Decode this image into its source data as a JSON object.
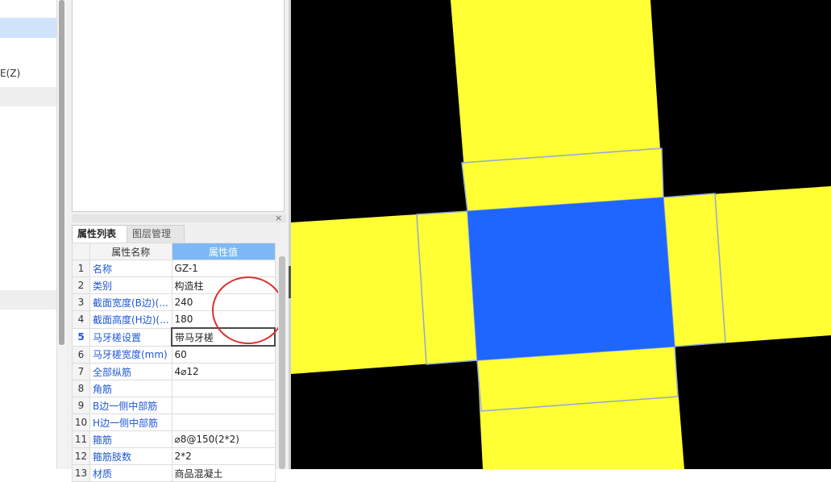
{
  "left_panel": {
    "truncated_label": "E(Z)"
  },
  "property_panel": {
    "tabs": [
      {
        "label": "属性列表",
        "active": true
      },
      {
        "label": "图层管理",
        "active": false
      }
    ],
    "close_glyph": "×",
    "columns": {
      "num": "",
      "name": "属性名称",
      "value": "属性值"
    },
    "selected_row": 5,
    "rows": [
      {
        "num": "1",
        "name": "名称",
        "value": "GZ-1"
      },
      {
        "num": "2",
        "name": "类别",
        "value": "构造柱"
      },
      {
        "num": "3",
        "name": "截面宽度(B边)(...",
        "value": "240"
      },
      {
        "num": "4",
        "name": "截面高度(H边)(...",
        "value": "180"
      },
      {
        "num": "5",
        "name": "马牙槎设置",
        "value": "带马牙槎"
      },
      {
        "num": "6",
        "name": "马牙槎宽度(mm)",
        "value": "60"
      },
      {
        "num": "7",
        "name": "全部纵筋",
        "value": "4⌀12"
      },
      {
        "num": "8",
        "name": "角筋",
        "value": ""
      },
      {
        "num": "9",
        "name": "B边一侧中部筋",
        "value": ""
      },
      {
        "num": "10",
        "name": "H边一侧中部筋",
        "value": ""
      },
      {
        "num": "11",
        "name": "箍筋",
        "value": "⌀8@150(2*2)"
      },
      {
        "num": "12",
        "name": "箍筋肢数",
        "value": "2*2"
      },
      {
        "num": "13",
        "name": "材质",
        "value": "商品混凝土"
      }
    ]
  },
  "canvas": {
    "background_color": "#000000",
    "column_color": "#1e66ff",
    "toothed_edge_color": "#ffff33",
    "edge_line_color": "#8fa8d8"
  }
}
